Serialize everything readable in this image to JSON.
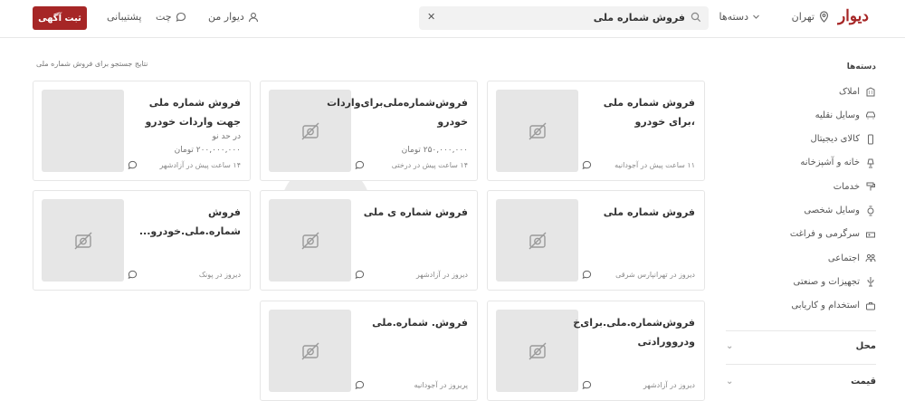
{
  "header": {
    "brand": "دیوار",
    "city": "تهران",
    "categories_label": "دسته‌ها",
    "search_query": "فروش شماره ملی",
    "my_divar": "دیوار من",
    "chat": "چت",
    "support": "پشتیبانی",
    "post_button": "ثبت آگهی"
  },
  "results_title": "نتایج جستجو برای فروش شماره ملی",
  "cards": [
    {
      "title": "فروش شماره ملی ،برای خودرو",
      "line1": "",
      "line2": "",
      "meta": "۱۱ ساعت پیش در آجودانیه",
      "photo": false
    },
    {
      "title": "فروش‌شماره‌ملی‌برای‌واردات خودرو",
      "line1": "",
      "line2": "۲۵۰,۰۰۰,۰۰۰ تومان",
      "meta": "۱۴ ساعت پیش در درختی",
      "photo": false
    },
    {
      "title": "فروش شماره ملی جهت واردات خودرو",
      "line1": "در حد نو",
      "line2": "۲۰۰,۰۰۰,۰۰۰ تومان",
      "meta": "۱۴ ساعت پیش در آزادشهر",
      "photo": true
    },
    {
      "title": "فروش شماره ملی",
      "line1": "",
      "line2": "",
      "meta": "دیروز در تهرانپارس شرقی",
      "photo": false
    },
    {
      "title": "فروش شماره ی ملی",
      "line1": "",
      "line2": "",
      "meta": "دیروز در آزادشهر",
      "photo": false
    },
    {
      "title": "فروش شماره.ملی.خودرو...",
      "line1": "",
      "line2": "",
      "meta": "دیروز در پونک",
      "photo": false
    },
    {
      "title": "فروش‌شماره.ملی.برای‌خ ودروورادتی",
      "line1": "",
      "line2": "",
      "meta": "دیروز در آزادشهر",
      "photo": false
    },
    {
      "title": "فروش. شماره.ملی",
      "line1": "",
      "line2": "",
      "meta": "پریروز در آجودانیه",
      "photo": false
    }
  ],
  "sidebar": {
    "heading": "دسته‌ها",
    "items": [
      {
        "label": "املاک",
        "icon": "building-icon"
      },
      {
        "label": "وسایل نقلیه",
        "icon": "car-icon"
      },
      {
        "label": "کالای دیجیتال",
        "icon": "phone-icon"
      },
      {
        "label": "خانه و آشپزخانه",
        "icon": "lamp-icon"
      },
      {
        "label": "خدمات",
        "icon": "paint-roller-icon"
      },
      {
        "label": "وسایل شخصی",
        "icon": "watch-icon"
      },
      {
        "label": "سرگرمی و فراغت",
        "icon": "game-icon"
      },
      {
        "label": "اجتماعی",
        "icon": "people-icon"
      },
      {
        "label": "تجهیزات و صنعتی",
        "icon": "tool-icon"
      },
      {
        "label": "استخدام و کاریابی",
        "icon": "briefcase-icon"
      }
    ],
    "filters": [
      "محل",
      "قیمت"
    ]
  },
  "colors": {
    "brand": "#a62626",
    "placeholder": "#e6e6e6",
    "border": "#e6e6e6"
  }
}
